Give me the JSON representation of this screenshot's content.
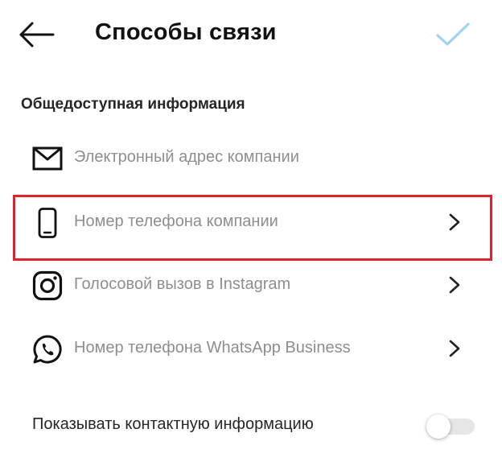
{
  "header": {
    "title": "Способы связи",
    "back_icon": "arrow-left-icon",
    "done_icon": "checkmark-icon",
    "done_color": "#9fd2f5"
  },
  "section": {
    "title": "Общедоступная информация"
  },
  "items": [
    {
      "icon": "mail-icon",
      "label": "Электронный адрес компании",
      "has_chevron": false
    },
    {
      "icon": "phone-icon",
      "label": "Номер телефона компании",
      "has_chevron": true,
      "highlighted": true
    },
    {
      "icon": "instagram-icon",
      "label": "Голосовой вызов в Instagram",
      "has_chevron": true
    },
    {
      "icon": "whatsapp-icon",
      "label": "Номер телефона WhatsApp Business",
      "has_chevron": true
    }
  ],
  "show_contact": {
    "label": "Показывать контактную информацию",
    "enabled": false
  },
  "colors": {
    "highlight": "#e0242f",
    "secondary_text": "#8e8e8e"
  }
}
